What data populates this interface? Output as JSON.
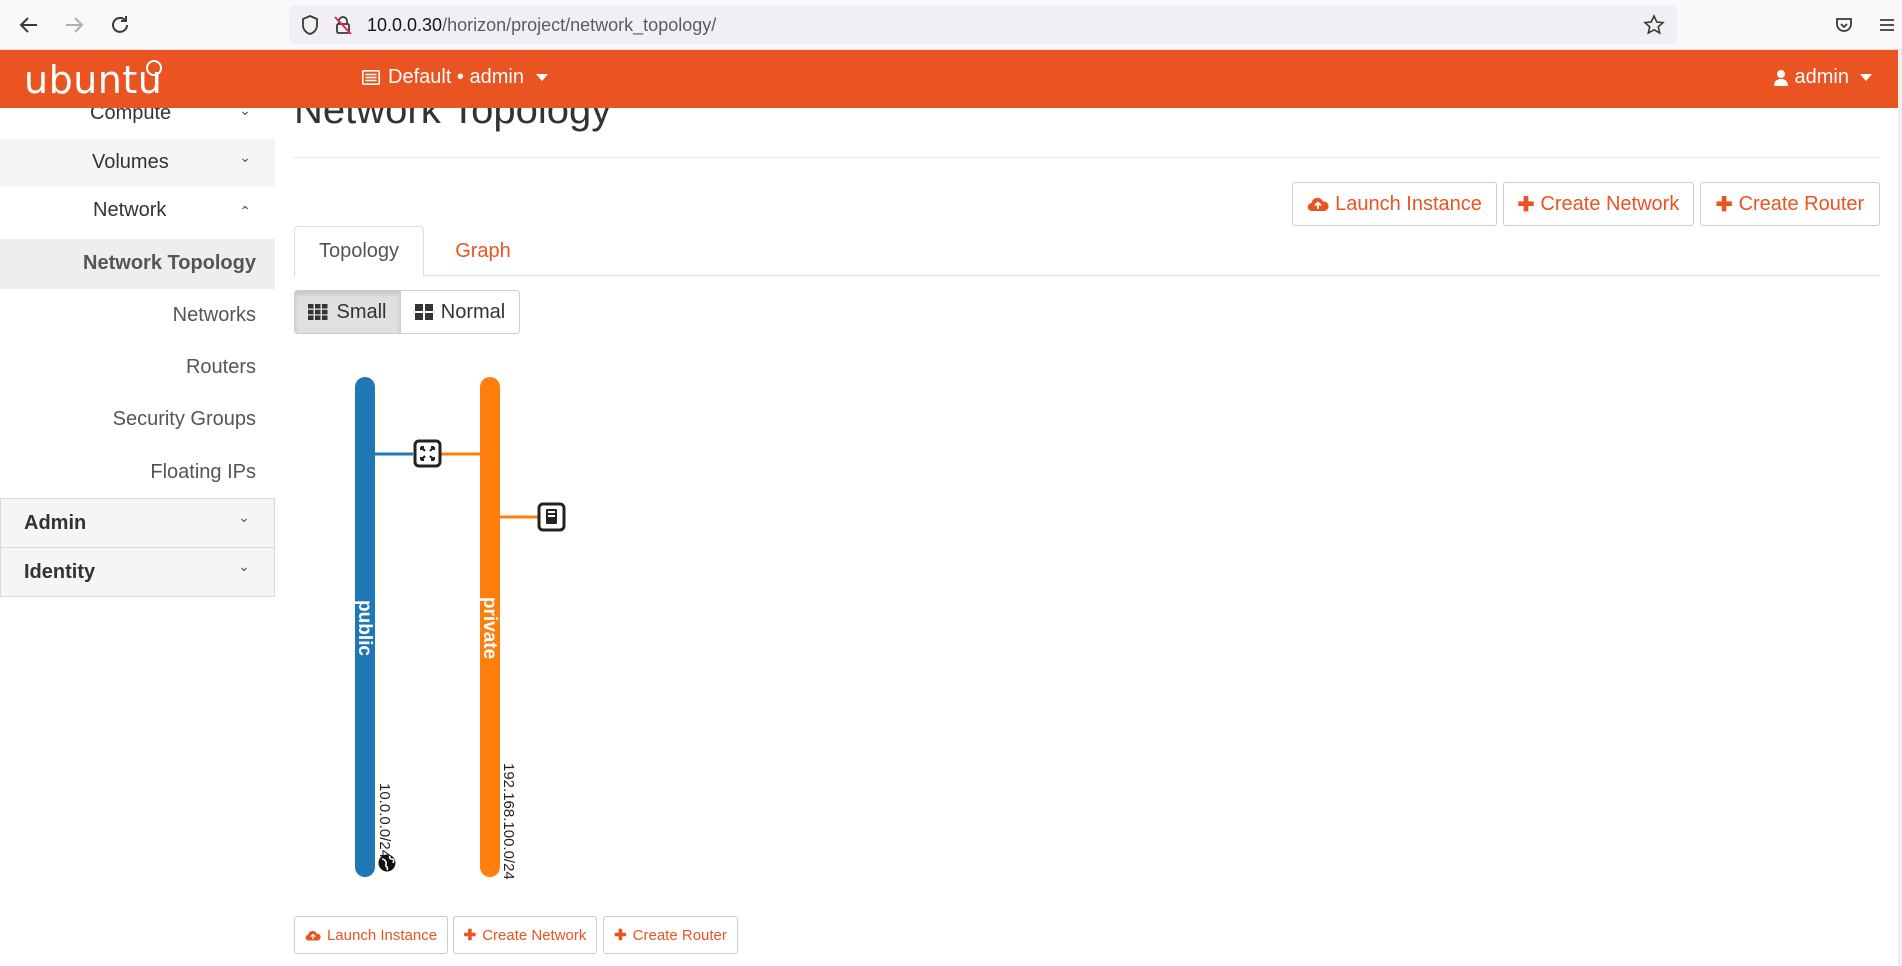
{
  "browser": {
    "url_host": "10.0.0.30",
    "url_path": "/horizon/project/network_topology/"
  },
  "navbar": {
    "brand": "ubuntu",
    "project_switch": "Default • admin",
    "user": "admin",
    "accent_color": "#e95420"
  },
  "sidebar": {
    "items": [
      {
        "label": "Compute",
        "expanded": false
      },
      {
        "label": "Volumes",
        "expanded": false
      },
      {
        "label": "Network",
        "expanded": true
      },
      {
        "label": "Network Topology",
        "active": true
      },
      {
        "label": "Networks"
      },
      {
        "label": "Routers"
      },
      {
        "label": "Security Groups"
      },
      {
        "label": "Floating IPs"
      },
      {
        "label": "Admin",
        "expanded": false
      },
      {
        "label": "Identity",
        "expanded": false
      }
    ]
  },
  "main": {
    "title": "Network Topology",
    "actions": {
      "launch_instance": "Launch Instance",
      "create_network": "Create Network",
      "create_router": "Create Router"
    },
    "tabs": [
      {
        "label": "Topology",
        "active": true
      },
      {
        "label": "Graph",
        "active": false
      }
    ],
    "view_toggle": {
      "small": "Small",
      "normal": "Normal",
      "selected": "Small"
    }
  },
  "topology": {
    "networks": [
      {
        "name": "public",
        "cidr": "10.0.0.0/24",
        "color": "#1f77b4",
        "external": true
      },
      {
        "name": "private",
        "cidr": "192.168.100.0/24",
        "color": "#ff7f0e",
        "external": false
      }
    ],
    "devices": [
      {
        "type": "router",
        "icon": "router-icon",
        "connects": [
          "public",
          "private"
        ]
      },
      {
        "type": "instance",
        "icon": "instance-icon",
        "connects": [
          "private"
        ]
      }
    ]
  }
}
